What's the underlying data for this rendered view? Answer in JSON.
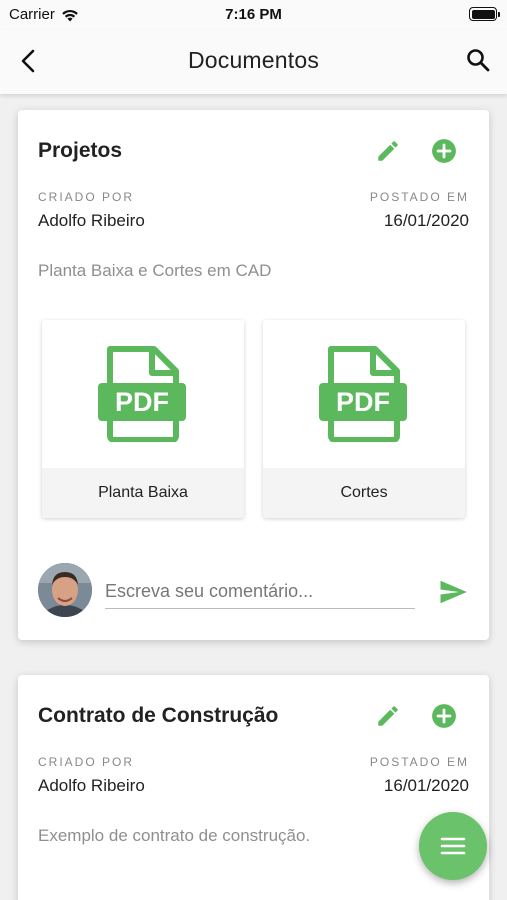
{
  "status_bar": {
    "carrier": "Carrier",
    "time": "7:16 PM"
  },
  "header": {
    "title": "Documentos",
    "back_icon": "chevron-left-icon",
    "search_icon": "search-icon"
  },
  "colors": {
    "accent": "#6ac26a",
    "icon_green": "#5cb85c"
  },
  "cards": [
    {
      "title": "Projetos",
      "created_by_label": "CRIADO POR",
      "created_by": "Adolfo Ribeiro",
      "posted_label": "POSTADO EM",
      "posted_date": "16/01/2020",
      "description": "Planta Baixa e Cortes em CAD",
      "files": [
        {
          "name": "Planta Baixa",
          "icon": "pdf-file-icon",
          "icon_text": "PDF"
        },
        {
          "name": "Cortes",
          "icon": "pdf-file-icon",
          "icon_text": "PDF"
        }
      ],
      "comment_placeholder": "Escreva seu comentário..."
    },
    {
      "title": "Contrato de Construção",
      "created_by_label": "CRIADO POR",
      "created_by": "Adolfo Ribeiro",
      "posted_label": "POSTADO EM",
      "posted_date": "16/01/2020",
      "description": "Exemplo de contrato de construção."
    }
  ],
  "fab": {
    "icon": "menu-icon"
  }
}
